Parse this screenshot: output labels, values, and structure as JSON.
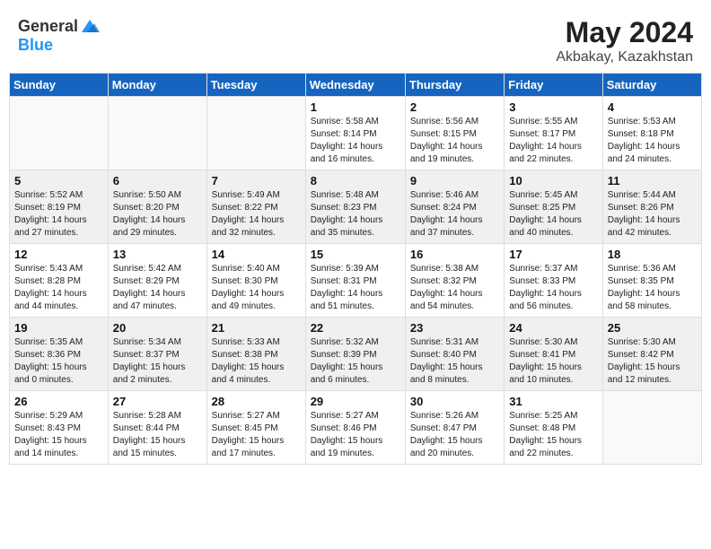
{
  "logo": {
    "general": "General",
    "blue": "Blue"
  },
  "title": {
    "month_year": "May 2024",
    "location": "Akbakay, Kazakhstan"
  },
  "weekdays": [
    "Sunday",
    "Monday",
    "Tuesday",
    "Wednesday",
    "Thursday",
    "Friday",
    "Saturday"
  ],
  "weeks": [
    [
      {
        "day": "",
        "info": ""
      },
      {
        "day": "",
        "info": ""
      },
      {
        "day": "",
        "info": ""
      },
      {
        "day": "1",
        "info": "Sunrise: 5:58 AM\nSunset: 8:14 PM\nDaylight: 14 hours\nand 16 minutes."
      },
      {
        "day": "2",
        "info": "Sunrise: 5:56 AM\nSunset: 8:15 PM\nDaylight: 14 hours\nand 19 minutes."
      },
      {
        "day": "3",
        "info": "Sunrise: 5:55 AM\nSunset: 8:17 PM\nDaylight: 14 hours\nand 22 minutes."
      },
      {
        "day": "4",
        "info": "Sunrise: 5:53 AM\nSunset: 8:18 PM\nDaylight: 14 hours\nand 24 minutes."
      }
    ],
    [
      {
        "day": "5",
        "info": "Sunrise: 5:52 AM\nSunset: 8:19 PM\nDaylight: 14 hours\nand 27 minutes."
      },
      {
        "day": "6",
        "info": "Sunrise: 5:50 AM\nSunset: 8:20 PM\nDaylight: 14 hours\nand 29 minutes."
      },
      {
        "day": "7",
        "info": "Sunrise: 5:49 AM\nSunset: 8:22 PM\nDaylight: 14 hours\nand 32 minutes."
      },
      {
        "day": "8",
        "info": "Sunrise: 5:48 AM\nSunset: 8:23 PM\nDaylight: 14 hours\nand 35 minutes."
      },
      {
        "day": "9",
        "info": "Sunrise: 5:46 AM\nSunset: 8:24 PM\nDaylight: 14 hours\nand 37 minutes."
      },
      {
        "day": "10",
        "info": "Sunrise: 5:45 AM\nSunset: 8:25 PM\nDaylight: 14 hours\nand 40 minutes."
      },
      {
        "day": "11",
        "info": "Sunrise: 5:44 AM\nSunset: 8:26 PM\nDaylight: 14 hours\nand 42 minutes."
      }
    ],
    [
      {
        "day": "12",
        "info": "Sunrise: 5:43 AM\nSunset: 8:28 PM\nDaylight: 14 hours\nand 44 minutes."
      },
      {
        "day": "13",
        "info": "Sunrise: 5:42 AM\nSunset: 8:29 PM\nDaylight: 14 hours\nand 47 minutes."
      },
      {
        "day": "14",
        "info": "Sunrise: 5:40 AM\nSunset: 8:30 PM\nDaylight: 14 hours\nand 49 minutes."
      },
      {
        "day": "15",
        "info": "Sunrise: 5:39 AM\nSunset: 8:31 PM\nDaylight: 14 hours\nand 51 minutes."
      },
      {
        "day": "16",
        "info": "Sunrise: 5:38 AM\nSunset: 8:32 PM\nDaylight: 14 hours\nand 54 minutes."
      },
      {
        "day": "17",
        "info": "Sunrise: 5:37 AM\nSunset: 8:33 PM\nDaylight: 14 hours\nand 56 minutes."
      },
      {
        "day": "18",
        "info": "Sunrise: 5:36 AM\nSunset: 8:35 PM\nDaylight: 14 hours\nand 58 minutes."
      }
    ],
    [
      {
        "day": "19",
        "info": "Sunrise: 5:35 AM\nSunset: 8:36 PM\nDaylight: 15 hours\nand 0 minutes."
      },
      {
        "day": "20",
        "info": "Sunrise: 5:34 AM\nSunset: 8:37 PM\nDaylight: 15 hours\nand 2 minutes."
      },
      {
        "day": "21",
        "info": "Sunrise: 5:33 AM\nSunset: 8:38 PM\nDaylight: 15 hours\nand 4 minutes."
      },
      {
        "day": "22",
        "info": "Sunrise: 5:32 AM\nSunset: 8:39 PM\nDaylight: 15 hours\nand 6 minutes."
      },
      {
        "day": "23",
        "info": "Sunrise: 5:31 AM\nSunset: 8:40 PM\nDaylight: 15 hours\nand 8 minutes."
      },
      {
        "day": "24",
        "info": "Sunrise: 5:30 AM\nSunset: 8:41 PM\nDaylight: 15 hours\nand 10 minutes."
      },
      {
        "day": "25",
        "info": "Sunrise: 5:30 AM\nSunset: 8:42 PM\nDaylight: 15 hours\nand 12 minutes."
      }
    ],
    [
      {
        "day": "26",
        "info": "Sunrise: 5:29 AM\nSunset: 8:43 PM\nDaylight: 15 hours\nand 14 minutes."
      },
      {
        "day": "27",
        "info": "Sunrise: 5:28 AM\nSunset: 8:44 PM\nDaylight: 15 hours\nand 15 minutes."
      },
      {
        "day": "28",
        "info": "Sunrise: 5:27 AM\nSunset: 8:45 PM\nDaylight: 15 hours\nand 17 minutes."
      },
      {
        "day": "29",
        "info": "Sunrise: 5:27 AM\nSunset: 8:46 PM\nDaylight: 15 hours\nand 19 minutes."
      },
      {
        "day": "30",
        "info": "Sunrise: 5:26 AM\nSunset: 8:47 PM\nDaylight: 15 hours\nand 20 minutes."
      },
      {
        "day": "31",
        "info": "Sunrise: 5:25 AM\nSunset: 8:48 PM\nDaylight: 15 hours\nand 22 minutes."
      },
      {
        "day": "",
        "info": ""
      }
    ]
  ]
}
